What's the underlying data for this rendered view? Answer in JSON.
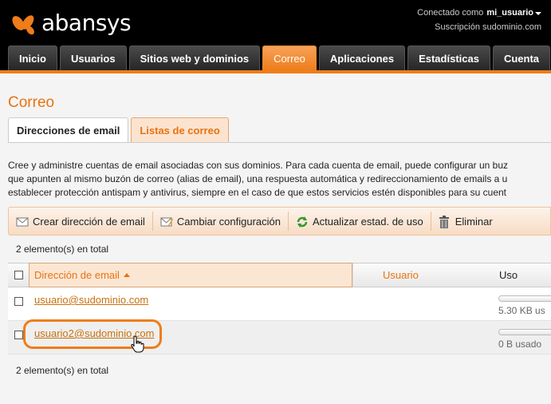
{
  "app": {
    "brand": "abansys",
    "connected_label": "Conectado como",
    "username": "mi_usuario",
    "subscription": "Suscripción sudominio.com"
  },
  "nav": {
    "tabs": [
      {
        "label": "Inicio"
      },
      {
        "label": "Usuarios"
      },
      {
        "label": "Sitios web y dominios"
      },
      {
        "label": "Correo"
      },
      {
        "label": "Aplicaciones"
      },
      {
        "label": "Estadísticas"
      },
      {
        "label": "Cuenta"
      }
    ],
    "active": "Correo"
  },
  "page": {
    "title": "Correo",
    "subtabs": [
      {
        "label": "Direcciones de email"
      },
      {
        "label": "Listas de correo"
      }
    ],
    "description": [
      "Cree y administre cuentas de email asociadas con sus dominios. Para cada cuenta de email, puede configurar un buz",
      "que apunten al mismo buzón de correo (alias de email), una respuesta automática y redireccionamiento de emails a u",
      "establecer protección antispam y antivirus, siempre en el caso de que estos servicios estén disponibles para su cuent"
    ]
  },
  "toolbar": {
    "create": "Crear dirección de email",
    "change": "Cambiar configuración",
    "refresh": "Actualizar estad. de uso",
    "delete": "Eliminar"
  },
  "list": {
    "count_top": "2 elemento(s) en total",
    "count_bottom": "2 elemento(s) en total",
    "columns": {
      "email": "Dirección de email",
      "user": "Usuario",
      "usage": "Uso"
    },
    "rows": [
      {
        "email": "usuario@sudominio.com",
        "usage_text": "5.30 KB us"
      },
      {
        "email": "usuario2@sudominio.com",
        "usage_text": "0 B usado"
      }
    ]
  },
  "colors": {
    "accent": "#ee7d1a",
    "link": "#c8720f",
    "header_bg": "#000000"
  }
}
